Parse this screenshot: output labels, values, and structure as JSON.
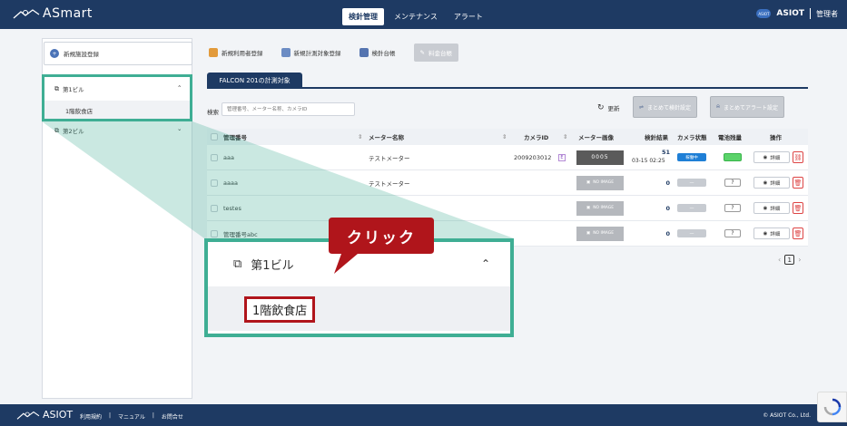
{
  "header": {
    "logo": "ASmart",
    "tabs": [
      {
        "label": "検針管理",
        "active": true
      },
      {
        "label": "メンテナンス",
        "active": false
      },
      {
        "label": "アラート",
        "active": false
      }
    ],
    "brand": "ASIOT",
    "role": "管理者"
  },
  "sidebar": {
    "register_button": "新規施設登録",
    "buildings": [
      {
        "label": "第1ビル",
        "expanded": true,
        "children": [
          "1階飲食店"
        ]
      },
      {
        "label": "第2ビル",
        "expanded": false,
        "children": []
      }
    ]
  },
  "toolbar": {
    "new_user": "新規利用者登録",
    "new_target": "新規計測対象登録",
    "ledger": "検針台帳",
    "fee_ledger": "料金台帳"
  },
  "main": {
    "tab_label": "FALCON 201の計測対象",
    "search_label": "検索",
    "search_placeholder": "管理番号、メーター名称、カメラID",
    "refresh": "更新",
    "bulk_reading": "まとめて検針設定",
    "bulk_alert": "まとめてアラート設定",
    "columns": [
      "管理番号",
      "メーター名称",
      "カメラID",
      "メーター画像",
      "検針結果",
      "カメラ状態",
      "電池残量",
      "操作"
    ],
    "rows": [
      {
        "id": "aaa",
        "meter": "テストメーター",
        "camera": "2009203012",
        "image": "0005",
        "result": "51",
        "time": "03-15 02:25",
        "status": "稼働中",
        "battery": "full",
        "detail": "詳細"
      },
      {
        "id": "aaaa",
        "meter": "テストメーター",
        "camera": "",
        "image": "NO IMAGE",
        "result": "0",
        "time": "",
        "status": "—",
        "battery": "?",
        "detail": "詳細"
      },
      {
        "id": "testes",
        "meter": "",
        "camera": "",
        "image": "NO IMAGE",
        "result": "0",
        "time": "",
        "status": "—",
        "battery": "?",
        "detail": "詳細"
      },
      {
        "id": "管理番号abc",
        "meter": "",
        "camera": "",
        "image": "NO IMAGE",
        "result": "0",
        "time": "",
        "status": "—",
        "battery": "?",
        "detail": "詳細"
      }
    ],
    "page": "1"
  },
  "zoom": {
    "building": "第1ビル",
    "floor": "1階飲食店",
    "callout": "クリック"
  },
  "footer": {
    "logo": "ASIOT",
    "links": [
      "利用規約",
      "マニュアル",
      "お問合せ"
    ],
    "copyright": "© ASIOT Co., Ltd."
  },
  "colors": {
    "primary": "#1e3a63",
    "highlight": "#3fae94",
    "callout": "#b0151b",
    "running": "#1f7fd6"
  }
}
